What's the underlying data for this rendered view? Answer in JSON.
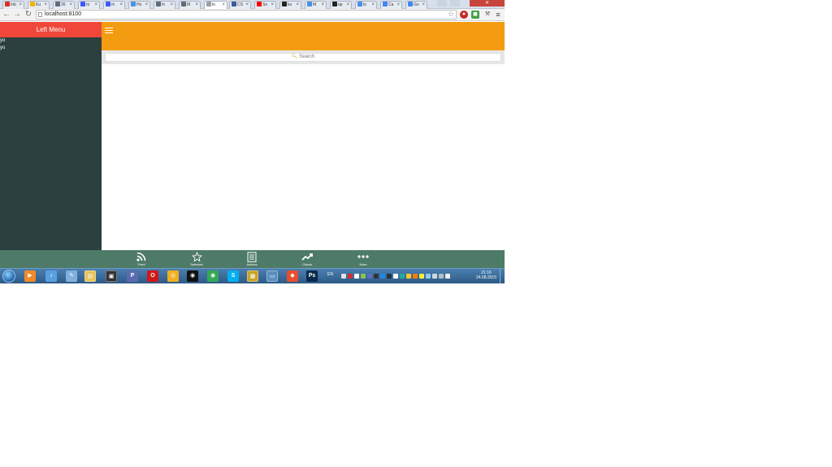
{
  "browser": {
    "tabs": [
      {
        "label": "Inb",
        "icon": "gmail-icon",
        "color": "#d93025",
        "active": false
      },
      {
        "label": "Ku",
        "icon": "bookmark-icon",
        "color": "#f4b400",
        "active": false
      },
      {
        "label": "26",
        "icon": "doc-icon",
        "color": "#5f6b7a",
        "active": false
      },
      {
        "label": "m",
        "icon": "shield-icon",
        "color": "#3d5afe",
        "active": false
      },
      {
        "label": "m",
        "icon": "shield-icon",
        "color": "#3d5afe",
        "active": false
      },
      {
        "label": "Ho",
        "icon": "dot-icon",
        "color": "#4a90e2",
        "active": false
      },
      {
        "label": "In",
        "icon": "doc-icon",
        "color": "#5f6b7a",
        "active": false
      },
      {
        "label": "M",
        "icon": "doc-icon",
        "color": "#5f6b7a",
        "active": false
      },
      {
        "label": "lo",
        "icon": "page-icon",
        "color": "#9aa0a6",
        "active": true
      },
      {
        "label": "CS",
        "icon": "b-icon",
        "color": "#3a5a99",
        "active": false
      },
      {
        "label": "So",
        "icon": "youtube-icon",
        "color": "#ff0000",
        "active": false
      },
      {
        "label": "ko",
        "icon": "github-icon",
        "color": "#222222",
        "active": false
      },
      {
        "label": "M",
        "icon": "dot-icon",
        "color": "#4a90e2",
        "active": false
      },
      {
        "label": "ap",
        "icon": "github-icon",
        "color": "#222222",
        "active": false
      },
      {
        "label": "lo",
        "icon": "dot-icon",
        "color": "#4a90e2",
        "active": false
      },
      {
        "label": "Ca",
        "icon": "google-icon",
        "color": "#4285f4",
        "active": false
      },
      {
        "label": "Go",
        "icon": "translate-icon",
        "color": "#4285f4",
        "active": false
      }
    ],
    "url": "localhost:8100"
  },
  "app": {
    "side_menu": {
      "title": "Left Menu",
      "items": [
        "yo",
        "yo"
      ]
    },
    "search": {
      "placeholder": "Search"
    },
    "tabs": [
      {
        "label": "Feed",
        "icon": "rss-icon"
      },
      {
        "label": "Selected",
        "icon": "star-icon"
      },
      {
        "label": "Actions",
        "icon": "list-icon"
      },
      {
        "label": "Charts",
        "icon": "trending-up-icon"
      },
      {
        "label": "More",
        "icon": "more-icon"
      }
    ]
  },
  "taskbar": {
    "language": "EN",
    "time": "21:16",
    "date": "24.08.2015",
    "apps": [
      {
        "icon": "media-player-icon",
        "glyph": "▶",
        "color": "#f08a24"
      },
      {
        "icon": "volume-icon",
        "glyph": "♪",
        "color": "#5aa0e0"
      },
      {
        "icon": "notepad-icon",
        "glyph": "✎",
        "color": "#7fb0de"
      },
      {
        "icon": "explorer-icon",
        "glyph": "▤",
        "color": "#e7c35a"
      },
      {
        "icon": "terminal-icon",
        "glyph": "▣",
        "color": "#333333"
      },
      {
        "icon": "php-icon",
        "glyph": "P",
        "color": "#5a6bb0"
      },
      {
        "icon": "opera-icon",
        "glyph": "O",
        "color": "#d01818"
      },
      {
        "icon": "chrome-canary-icon",
        "glyph": "◎",
        "color": "#f0b020"
      },
      {
        "icon": "steam-icon",
        "glyph": "◉",
        "color": "#111111"
      },
      {
        "icon": "chrome-icon",
        "glyph": "◉",
        "color": "#34a853"
      },
      {
        "icon": "skype-icon",
        "glyph": "S",
        "color": "#00aff0"
      },
      {
        "icon": "calendar-icon",
        "glyph": "▦",
        "color": "#c9a227"
      },
      {
        "icon": "remote-desktop-icon",
        "glyph": "▭",
        "color": "#5a8fc0"
      },
      {
        "icon": "git-icon",
        "glyph": "◆",
        "color": "#e84e31"
      },
      {
        "icon": "photoshop-icon",
        "glyph": "Ps",
        "color": "#0b2a4a"
      }
    ]
  },
  "colors": {
    "header": "#f39c12",
    "side_menu_header": "#ef473a",
    "side_menu_bg": "#2b403f",
    "tabs_bg": "#4e7b68"
  }
}
